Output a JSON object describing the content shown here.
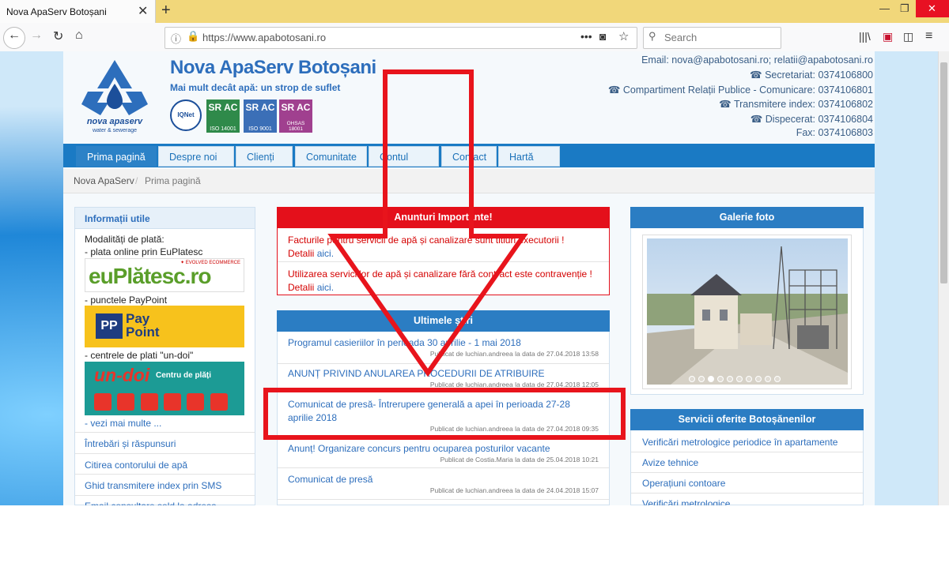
{
  "browser": {
    "tab_title": "Nova ApaServ Botoșani",
    "url": "https://www.apabotosani.ro",
    "search_placeholder": "Search"
  },
  "header": {
    "title": "Nova ApaServ Botoșani",
    "slogan": "Mai mult decât apă: un strop de suflet",
    "logo_text": "nova apaserv",
    "logo_sub": "water & sewerage",
    "certs": [
      "IQNet",
      "ISO 14001",
      "ISO 9001",
      "OHSAS 18001"
    ],
    "cert_mark": "SR AC",
    "contacts": {
      "email": "Email: nova@apabotosani.ro; relatii@apabotosani.ro",
      "secretariat": "Secretariat: 0374106800",
      "relatii": "Compartiment Relații Publice - Comunicare: 0374106801",
      "index": "Transmitere index: 0374106802",
      "dispecerat": "Dispecerat: 0374106804",
      "fax": "Fax: 0374106803"
    }
  },
  "menu": [
    "Prima pagină",
    "Despre noi ▾",
    "Clienți ▾",
    "Comunitate",
    "Contul meu",
    "Contact",
    "Hartă site"
  ],
  "breadcrumb": {
    "home": "Nova ApaServ",
    "sep": "/",
    "current": "Prima pagină"
  },
  "left": {
    "title": "Informații utile",
    "payment_label": "Modalități de plată:",
    "online": "- plata online prin EuPlatesc",
    "euplatesc_logo": "euPlătesc.ro",
    "euplatesc_tag": "✦ EVOLVED ECOMMERCE",
    "paypoint_label": "- punctele PayPoint",
    "paypoint_logo": "Pay Point",
    "paypoint_badge": "PP",
    "undoi_label": "- centrele de plati \"un-doi\"",
    "undoi_logo": "un-doi",
    "undoi_tag": "Centru de plăți",
    "more": "- vezi mai multe ...",
    "links": [
      "Întrebări și răspunsuri",
      "Citirea contorului de apă",
      "Ghid transmitere index prin SMS",
      "Email consultare sold la adresa"
    ]
  },
  "important": {
    "title": "Anunturi Importante!",
    "items": [
      {
        "text": "Facturile pentru servicii de apă și canalizare sunt titluri executorii !",
        "detail": "Detalii",
        "link": "aici."
      },
      {
        "text": "Utilizarea serviciilor de apă și canalizare fără contract este contravenție !",
        "detail": "Detalii",
        "link": "aici."
      }
    ]
  },
  "news": {
    "title": "Ultimele știri",
    "items": [
      {
        "title": "Programul casieriilor în perioada 30 aprilie - 1 mai 2018",
        "meta": "Publicat de luchian.andreea la data de 27.04.2018 13:58"
      },
      {
        "title": "ANUNȚ PRIVIND ANULAREA PROCEDURII DE ATRIBUIRE",
        "meta": "Publicat de luchian.andreea la data de 27.04.2018 12:05"
      },
      {
        "title": "Comunicat de presă- Întrerupere generală a apei în perioada 27-28 aprilie 2018",
        "meta": "Publicat de luchian.andreea la data de 27.04.2018 09:35"
      },
      {
        "title": "Anunț! Organizare concurs pentru ocuparea posturilor vacante",
        "meta": "Publicat de Costia.Maria la data de 25.04.2018 10:21"
      },
      {
        "title": "Comunicat de presă",
        "meta": "Publicat de luchian.andreea la data de 24.04.2018 15:07"
      }
    ]
  },
  "gallery": {
    "title": "Galerie foto",
    "dots": 10,
    "active_dot": 3
  },
  "services": {
    "title": "Servicii oferite Botoșănenilor",
    "items": [
      "Verificări metrologice periodice în apartamente",
      "Avize tehnice",
      "Operațiuni contoare",
      "Verificări metrologice"
    ]
  },
  "colors": {
    "brand": "#2d6ebc",
    "menu": "#1a7ac4",
    "alert": "#e4101b",
    "annotation": "#e8141c"
  }
}
